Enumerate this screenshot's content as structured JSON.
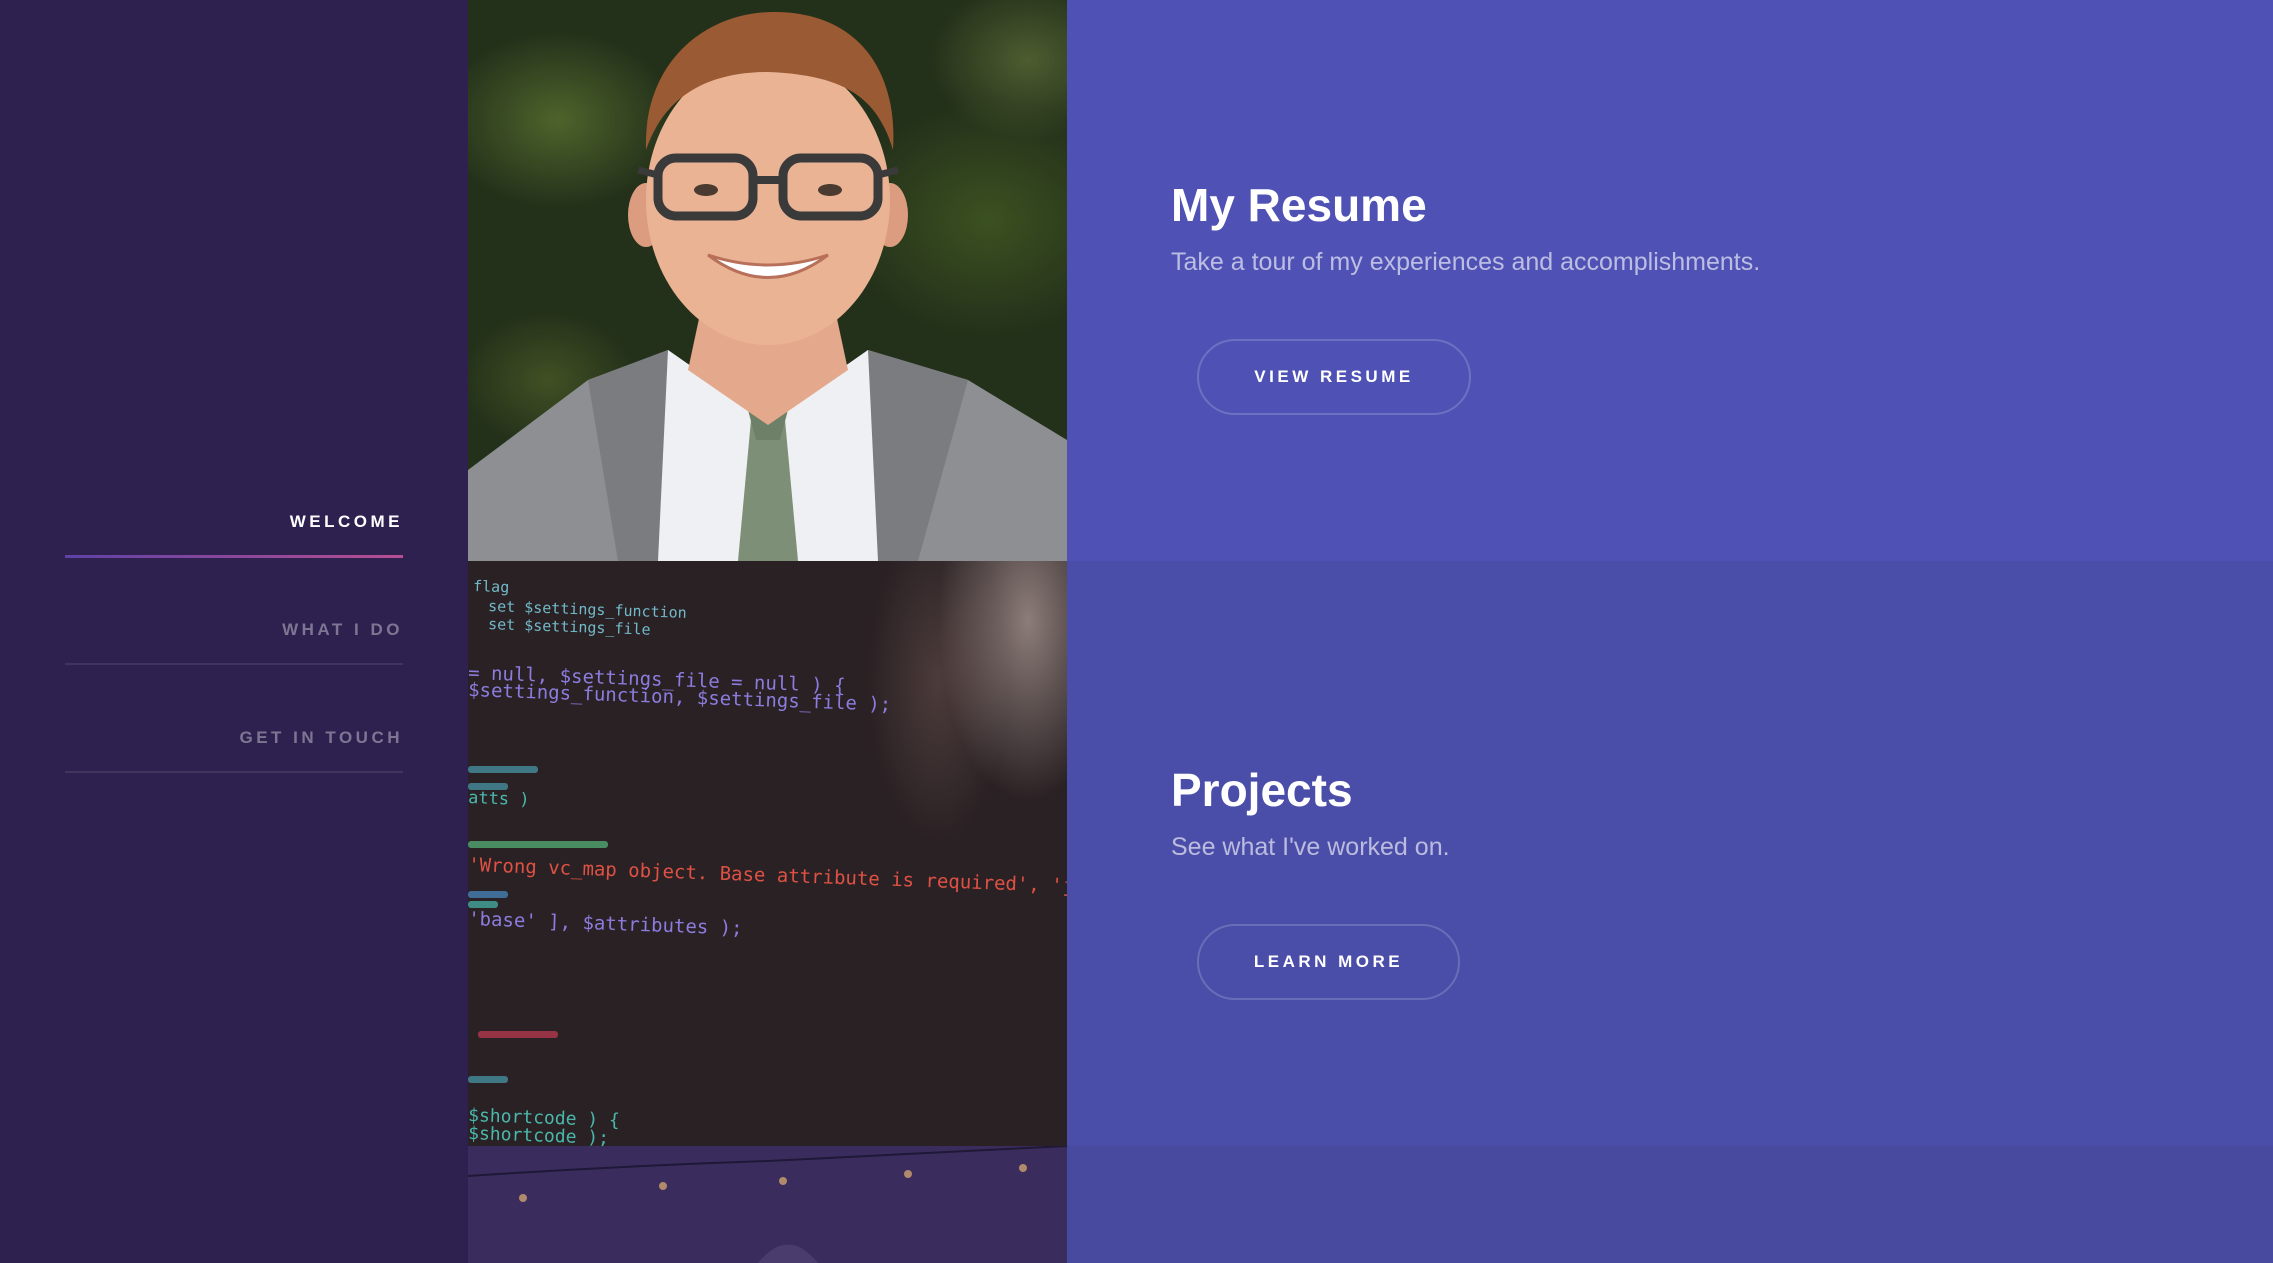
{
  "nav": {
    "items": [
      {
        "label": "Welcome",
        "active": true
      },
      {
        "label": "What I Do",
        "active": false
      },
      {
        "label": "Get in Touch",
        "active": false
      }
    ]
  },
  "sections": [
    {
      "title": "My Resume",
      "description": "Take a tour of my experiences and accomplishments.",
      "button": "View Resume"
    },
    {
      "title": "Projects",
      "description": "See what I've worked on.",
      "button": "Learn More"
    }
  ],
  "code_lines": [
    {
      "color": "#7fd4e6",
      "text": "flag"
    },
    {
      "color": "#7fd4e6",
      "text": "set $settings_function"
    },
    {
      "color": "#7fd4e6",
      "text": "set $settings_file"
    },
    {
      "color": "#9c8cff",
      "text": "= null, $settings_file = null ) {"
    },
    {
      "color": "#9c8cff",
      "text": "$settings_function, $settings_file );"
    },
    {
      "color": "#4fd3c4",
      "text": "atts )"
    },
    {
      "color": "#ff5a4a",
      "text": "'Wrong vc_map object. Base attribute is required', 'js_composer'"
    },
    {
      "color": "#9c8cff",
      "text": "'base' ], $attributes );"
    },
    {
      "color": "#4fd3c4",
      "text": "$shortcode ) {"
    },
    {
      "color": "#4fd3c4",
      "text": "$shortcode );"
    }
  ],
  "colors": {
    "sidebar": "#2e2150",
    "section1": "#4f52b4",
    "section2": "#4a4ea8",
    "section3": "#474a9f",
    "accent_start": "#5e42a6",
    "accent_end": "#b74e91"
  }
}
